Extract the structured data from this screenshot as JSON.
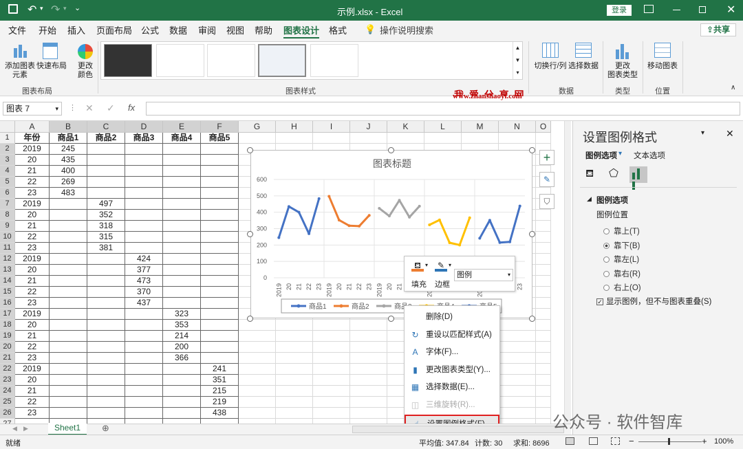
{
  "titlebar": {
    "filename": "示例.xlsx - Excel",
    "login": "登录",
    "qat_more": "⌄",
    "share": "共享"
  },
  "tabs": [
    "文件",
    "开始",
    "插入",
    "页面布局",
    "公式",
    "数据",
    "审阅",
    "视图",
    "帮助",
    "图表设计",
    "格式"
  ],
  "active_tab": "图表设计",
  "tell_me": "操作说明搜索",
  "ribbon": {
    "add_element": "添加图表\n元素",
    "quick_layout": "快速布局",
    "change_color": "更改\n颜色",
    "group_layout": "图表布局",
    "group_styles": "图表样式",
    "switch_rowcol": "切换行/列",
    "select_data": "选择数据",
    "group_data": "数据",
    "change_type": "更改\n图表类型",
    "group_type": "类型",
    "move_chart": "移动图表",
    "group_location": "位置"
  },
  "watermark": {
    "title": "我 爱 分 享 网",
    "url": "www.zhanshaoyi.com",
    "bottom": "公众号 · 软件智库"
  },
  "formula": {
    "namebox": "图表 7",
    "fx": "fx",
    "value": ""
  },
  "columns": [
    "A",
    "B",
    "C",
    "D",
    "E",
    "F",
    "G",
    "H",
    "I",
    "J",
    "K",
    "L",
    "M",
    "N",
    "O"
  ],
  "rows": [
    "1",
    "2",
    "3",
    "4",
    "5",
    "6",
    "7",
    "8",
    "9",
    "10",
    "11",
    "12",
    "13",
    "14",
    "15",
    "16",
    "17",
    "18",
    "19",
    "20",
    "21",
    "22",
    "23",
    "24",
    "25",
    "26",
    "27"
  ],
  "headers": [
    "年份",
    "商品1",
    "商品2",
    "商品3",
    "商品4",
    "商品5"
  ],
  "table": [
    [
      "2019",
      "245",
      "",
      "",
      "",
      ""
    ],
    [
      "20",
      "435",
      "",
      "",
      "",
      ""
    ],
    [
      "21",
      "400",
      "",
      "",
      "",
      ""
    ],
    [
      "22",
      "269",
      "",
      "",
      "",
      ""
    ],
    [
      "23",
      "483",
      "",
      "",
      "",
      ""
    ],
    [
      "2019",
      "",
      "497",
      "",
      "",
      ""
    ],
    [
      "20",
      "",
      "352",
      "",
      "",
      ""
    ],
    [
      "21",
      "",
      "318",
      "",
      "",
      ""
    ],
    [
      "22",
      "",
      "315",
      "",
      "",
      ""
    ],
    [
      "23",
      "",
      "381",
      "",
      "",
      ""
    ],
    [
      "2019",
      "",
      "",
      "424",
      "",
      ""
    ],
    [
      "20",
      "",
      "",
      "377",
      "",
      ""
    ],
    [
      "21",
      "",
      "",
      "473",
      "",
      ""
    ],
    [
      "22",
      "",
      "",
      "370",
      "",
      ""
    ],
    [
      "23",
      "",
      "",
      "437",
      "",
      ""
    ],
    [
      "2019",
      "",
      "",
      "",
      "323",
      ""
    ],
    [
      "20",
      "",
      "",
      "",
      "353",
      ""
    ],
    [
      "21",
      "",
      "",
      "",
      "214",
      ""
    ],
    [
      "22",
      "",
      "",
      "",
      "200",
      ""
    ],
    [
      "23",
      "",
      "",
      "",
      "366",
      ""
    ],
    [
      "2019",
      "",
      "",
      "",
      "",
      "241"
    ],
    [
      "20",
      "",
      "",
      "",
      "",
      "351"
    ],
    [
      "21",
      "",
      "",
      "",
      "",
      "215"
    ],
    [
      "22",
      "",
      "",
      "",
      "",
      "219"
    ],
    [
      "23",
      "",
      "",
      "",
      "",
      "438"
    ]
  ],
  "chart_data": {
    "type": "line",
    "title": "图表标题",
    "ylim": [
      0,
      600
    ],
    "yticks": [
      "0",
      "100",
      "200",
      "300",
      "400",
      "500",
      "600"
    ],
    "categories": [
      "2019",
      "20",
      "21",
      "22",
      "23"
    ],
    "series": [
      {
        "name": "商品1",
        "color": "#4472c4",
        "values": [
          245,
          435,
          400,
          269,
          483
        ]
      },
      {
        "name": "商品2",
        "color": "#ed7d31",
        "values": [
          497,
          352,
          318,
          315,
          381
        ]
      },
      {
        "name": "商品3",
        "color": "#a5a5a5",
        "values": [
          424,
          377,
          473,
          370,
          437
        ]
      },
      {
        "name": "商品4",
        "color": "#ffc000",
        "values": [
          323,
          353,
          214,
          200,
          366
        ]
      },
      {
        "name": "商品5",
        "color": "#4472c4",
        "values": [
          241,
          351,
          215,
          219,
          438
        ]
      }
    ],
    "grid": true,
    "legend": "bottom"
  },
  "minitoolbar": {
    "fill": "填充",
    "border": "边框",
    "dropdown": "图例"
  },
  "context_menu": [
    {
      "label": "删除(D)",
      "icon": "",
      "enabled": true
    },
    {
      "label": "重设以匹配样式(A)",
      "icon": "reset-icon",
      "enabled": true
    },
    {
      "label": "字体(F)...",
      "icon": "font-icon",
      "enabled": true
    },
    {
      "label": "更改图表类型(Y)...",
      "icon": "chart-type-icon",
      "enabled": true
    },
    {
      "label": "选择数据(E)...",
      "icon": "select-data-icon",
      "enabled": true
    },
    {
      "label": "三维旋转(R)...",
      "icon": "rotate-3d-icon",
      "enabled": false
    },
    {
      "label": "设置图例格式(F)...",
      "icon": "format-icon",
      "enabled": true
    }
  ],
  "pane": {
    "title": "设置图例格式",
    "tab1": "图例选项",
    "tab2": "文本选项",
    "section": "图例选项",
    "position_label": "图例位置",
    "options": [
      "靠上(T)",
      "靠下(B)",
      "靠左(L)",
      "靠右(R)",
      "右上(O)"
    ],
    "selected": "靠下(B)",
    "checkbox": "显示图例，但不与图表重叠(S)"
  },
  "sheet_tab": "Sheet1",
  "status": {
    "ready": "就绪",
    "avg": "平均值: 347.84",
    "count": "计数: 30",
    "sum": "求和: 8696",
    "zoom": "100%"
  }
}
